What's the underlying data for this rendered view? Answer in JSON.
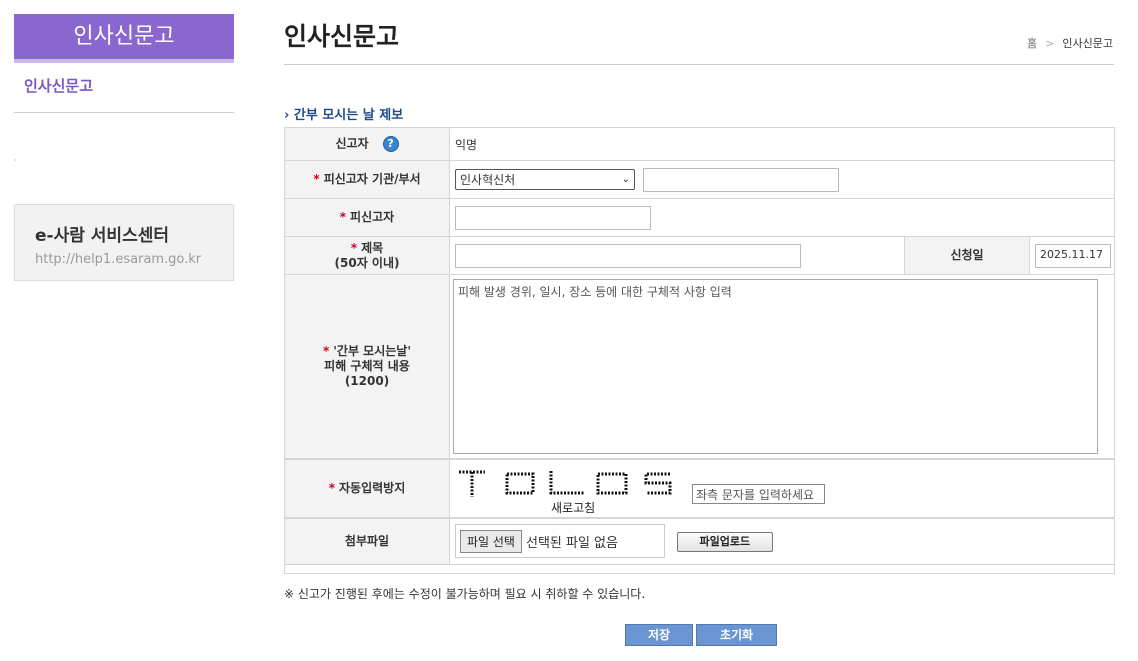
{
  "sidebar": {
    "title": "인사신문고",
    "menu_item": "인사신문고",
    "service_center": {
      "title": "e-사람 서비스센터",
      "url": "http://help1.esaram.go.kr"
    }
  },
  "header": {
    "title": "인사신문고",
    "breadcrumb": [
      "홈",
      "인사신문고"
    ]
  },
  "section_title": "간부 모시는 날 제보",
  "form": {
    "reporter": {
      "label": "신고자",
      "value": "익명",
      "help_icon": "question-mark-icon"
    },
    "target_org": {
      "label": "피신고자 기관/부서",
      "selected": "인사혁신처",
      "dept_value": ""
    },
    "target_person": {
      "label": "피신고자",
      "value": ""
    },
    "subject": {
      "label": "제목",
      "sublabel": "(50자 이내)",
      "value": ""
    },
    "apply_date": {
      "label": "신청일",
      "value": "2025.11.17"
    },
    "detail": {
      "label_line1": "'간부 모시는날'",
      "label_line2": "피해 구체적 내용",
      "label_line3": "(1200)",
      "placeholder": "피해 발생 경위, 일시, 장소 등에 대한  구체적 사항 입력"
    },
    "captcha": {
      "label": "자동입력방지",
      "text": "TCLOS",
      "refresh": "새로고침",
      "placeholder": "좌측 문자를 입력하세요"
    },
    "attachment": {
      "label": "첨부파일",
      "choose_button": "파일 선택",
      "no_file": "선택된 파일 없음",
      "upload_button": "파일업로드"
    }
  },
  "notice": "※ 신고가 진행된 후에는 수정이 불가능하며 필요 시 취하할 수 있습니다.",
  "buttons": {
    "save": "저장",
    "reset": "초기화"
  },
  "colors": {
    "brand": "#8a67cf",
    "section": "#1d4c85",
    "required": "#d0021b",
    "button": "#6b95d0"
  }
}
